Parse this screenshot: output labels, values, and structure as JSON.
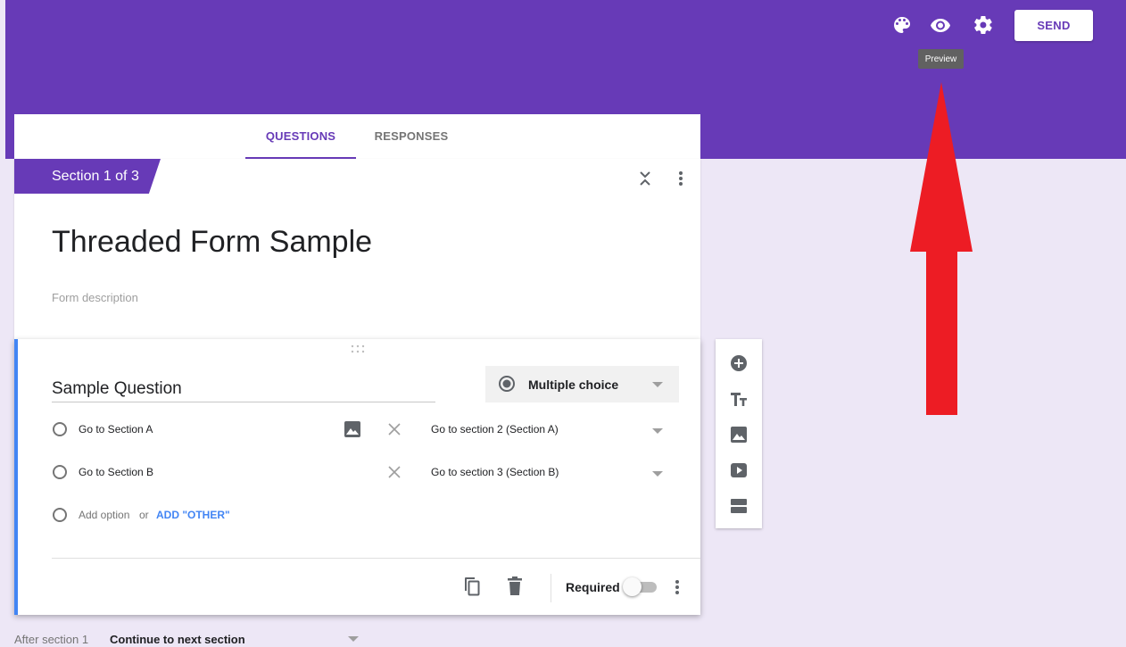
{
  "header": {
    "palette_icon": "palette-icon",
    "preview_icon": "eye-icon",
    "settings_icon": "gear-icon",
    "send_label": "SEND",
    "tooltip": "Preview",
    "annotation_color": "#ed1c24",
    "brand_color": "#673ab7"
  },
  "tabs": [
    {
      "label": "QUESTIONS",
      "active": true
    },
    {
      "label": "RESPONSES",
      "active": false
    }
  ],
  "section": {
    "label": "Section 1 of 3",
    "title": "Threaded Form Sample",
    "description_placeholder": "Form description"
  },
  "question": {
    "title": "Sample Question",
    "type": "Multiple choice",
    "options": [
      {
        "label": "Go to Section A",
        "goto": "Go to section 2 (Section A)"
      },
      {
        "label": "Go to Section B",
        "goto": "Go to section 3 (Section B)"
      }
    ],
    "add_option": "Add option",
    "or": "or",
    "add_other": "ADD \"OTHER\"",
    "required_label": "Required",
    "required": false
  },
  "side_toolbar": [
    "add-question-icon",
    "title-text-icon",
    "image-icon",
    "video-icon",
    "section-icon"
  ],
  "after_section": {
    "label": "After section 1",
    "value": "Continue to next section"
  }
}
